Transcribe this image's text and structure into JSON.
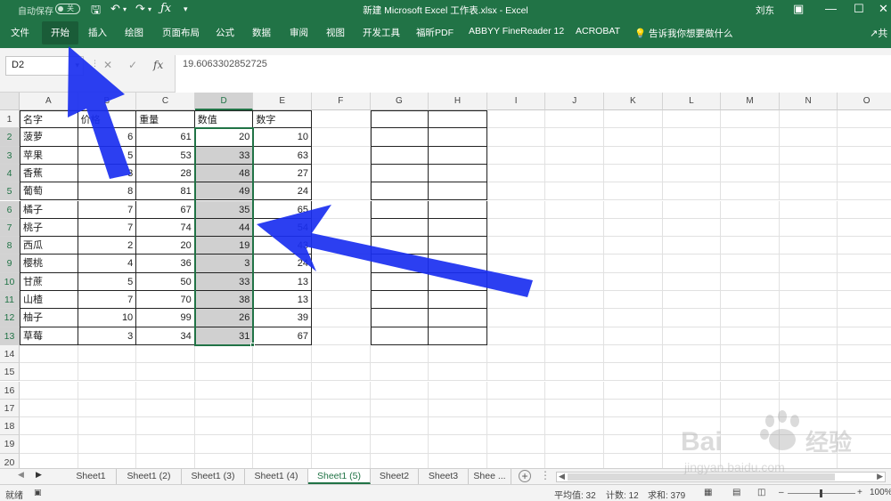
{
  "titlebar": {
    "autosave_label": "自动保存",
    "toggle_state": "关",
    "title": "新建 Microsoft Excel 工作表.xlsx  -  Excel",
    "user": "刘东"
  },
  "ribbon": {
    "tabs": [
      "文件",
      "开始",
      "插入",
      "绘图",
      "页面布局",
      "公式",
      "数据",
      "审阅",
      "视图",
      "开发工具",
      "福昕PDF",
      "ABBYY FineReader 12",
      "ACROBAT"
    ],
    "active_tab": "开始",
    "tell_me": "告诉我你想要做什么",
    "share": "共"
  },
  "formula_bar": {
    "name_box": "D2",
    "fx": "fx",
    "formula": "19.6063302852725"
  },
  "columns": [
    "A",
    "B",
    "C",
    "D",
    "E",
    "F",
    "G",
    "H",
    "I",
    "J",
    "K",
    "L",
    "M",
    "N",
    "O"
  ],
  "rows": [
    "1",
    "2",
    "3",
    "4",
    "5",
    "6",
    "7",
    "8",
    "9",
    "10",
    "11",
    "12",
    "13",
    "14",
    "15",
    "16",
    "17",
    "18",
    "19",
    "20"
  ],
  "table": {
    "headers": [
      "名字",
      "价格",
      "重量",
      "数值",
      "数字"
    ],
    "rows": [
      [
        "菠萝",
        "6",
        "61",
        "20",
        "10"
      ],
      [
        "苹果",
        "5",
        "53",
        "33",
        "63"
      ],
      [
        "香蕉",
        "3",
        "28",
        "48",
        "27"
      ],
      [
        "葡萄",
        "8",
        "81",
        "49",
        "24"
      ],
      [
        "橘子",
        "7",
        "67",
        "35",
        "65"
      ],
      [
        "桃子",
        "7",
        "74",
        "44",
        "54"
      ],
      [
        "西瓜",
        "2",
        "20",
        "19",
        "43"
      ],
      [
        "樱桃",
        "4",
        "36",
        "3",
        "24"
      ],
      [
        "甘蔗",
        "5",
        "50",
        "33",
        "13"
      ],
      [
        "山楂",
        "7",
        "70",
        "38",
        "13"
      ],
      [
        "柚子",
        "10",
        "99",
        "26",
        "39"
      ],
      [
        "草莓",
        "3",
        "34",
        "31",
        "67"
      ]
    ]
  },
  "sheets": [
    "Sheet1",
    "Sheet1 (2)",
    "Sheet1 (3)",
    "Sheet1 (4)",
    "Sheet1 (5)",
    "Sheet2",
    "Sheet3",
    "Shee ..."
  ],
  "active_sheet": "Sheet1 (5)",
  "status": {
    "ready": "就绪",
    "average": "平均值: 32",
    "count": "计数: 12",
    "sum": "求和: 379",
    "zoom": "100%"
  },
  "watermark": "Baidu经验 jingyan.baidu.com",
  "colors": {
    "excel_green": "#217346",
    "arrow_blue": "#1a2ff0",
    "selection_gray": "#d0d0d0"
  }
}
